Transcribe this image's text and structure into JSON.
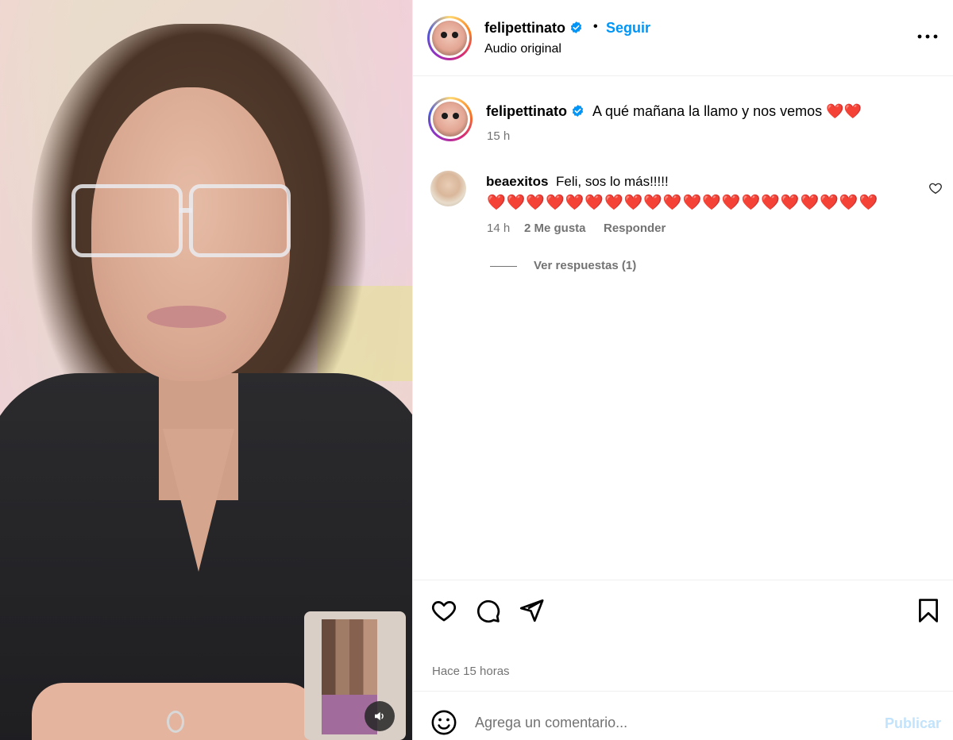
{
  "header": {
    "username": "felipettinato",
    "separator": "•",
    "follow_label": "Seguir",
    "audio_label": "Audio original"
  },
  "caption": {
    "username": "felipettinato",
    "text": "A qué mañana la llamo y nos vemos ❤️❤️",
    "time": "15 h"
  },
  "comment": {
    "username": "beaexitos",
    "text": "Feli, sos lo más!!!!!",
    "hearts": "❤️❤️❤️❤️❤️❤️❤️❤️❤️❤️❤️❤️❤️❤️❤️❤️❤️❤️❤️❤️",
    "time": "14 h",
    "likes_label": "2 Me gusta",
    "reply_label": "Responder",
    "view_replies_label": "Ver respuestas (1)"
  },
  "post": {
    "time_label": "Hace 15 horas"
  },
  "comment_box": {
    "placeholder": "Agrega un comentario...",
    "publish_label": "Publicar"
  },
  "colors": {
    "accent": "#0095f6",
    "secondary_text": "#737373",
    "publish_disabled": "#c2e3fc",
    "heart": "#e0262a"
  },
  "icons": [
    "verified-badge-icon",
    "more-options-icon",
    "like-icon",
    "comment-icon",
    "share-icon",
    "save-icon",
    "emoji-icon",
    "speaker-icon",
    "comment-like-icon"
  ]
}
